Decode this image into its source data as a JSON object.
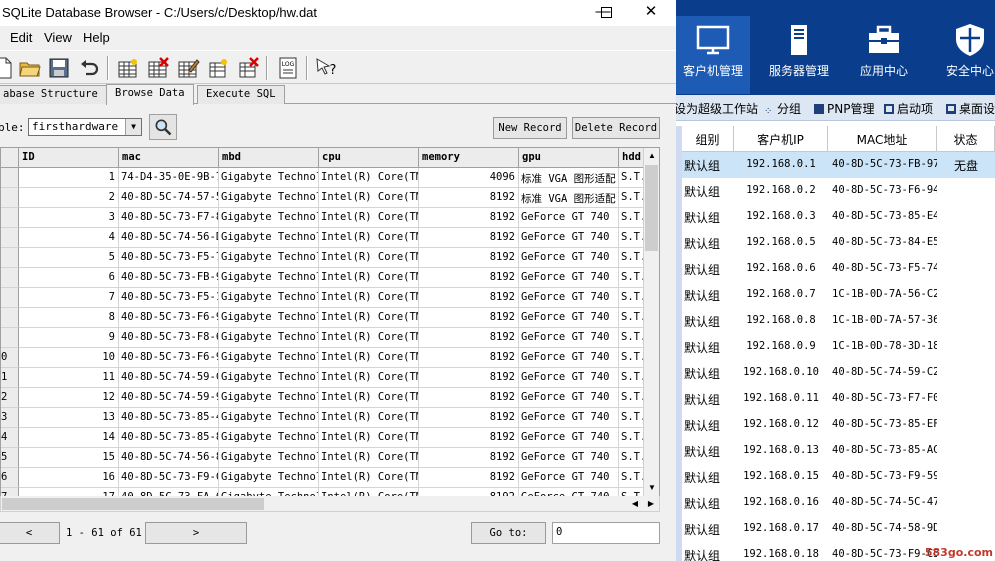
{
  "sqlite": {
    "title": "SQLite Database Browser - C:/Users/c/Desktop/hw.dat",
    "window_controls": {
      "minimize": "—",
      "maximize": "☐",
      "close": "✕"
    },
    "menu": [
      "Edit",
      "View",
      "Help"
    ],
    "toolbar_icons": [
      "new-database-icon",
      "open-database-icon",
      "save-icon",
      "undo-icon",
      "create-table-icon",
      "delete-table-icon",
      "modify-table-icon",
      "create-index-icon",
      "delete-index-icon",
      "log-icon",
      "whats-this-icon"
    ],
    "tabs": [
      "abase Structure",
      "Browse Data",
      "Execute SQL"
    ],
    "active_tab": 1,
    "table_label": "ble:",
    "table_selected": "firsthardware",
    "buttons": {
      "new_record": "New Record",
      "delete_record": "Delete Record"
    },
    "columns": [
      "ID",
      "mac",
      "mbd",
      "cpu",
      "memory",
      "gpu",
      "hdd"
    ],
    "rows": [
      {
        "rownum": "",
        "id": "1",
        "mac": "74-D4-35-0E-9B-7",
        "mbd": "Gigabyte Technol",
        "cpu": "Intel(R) Core(TM",
        "memory": "4096",
        "gpu": "标准 VGA 图形适配",
        "hdd": "S.T."
      },
      {
        "rownum": "",
        "id": "2",
        "mac": "40-8D-5C-74-57-5",
        "mbd": "Gigabyte Technol",
        "cpu": "Intel(R) Core(TM",
        "memory": "8192",
        "gpu": "标准 VGA 图形适配",
        "hdd": "S.T."
      },
      {
        "rownum": "",
        "id": "3",
        "mac": "40-8D-5C-73-F7-8",
        "mbd": "Gigabyte Technol",
        "cpu": "Intel(R) Core(TM",
        "memory": "8192",
        "gpu": "GeForce GT 740",
        "hdd": "S.T."
      },
      {
        "rownum": "",
        "id": "4",
        "mac": "40-8D-5C-74-56-D",
        "mbd": "Gigabyte Technol",
        "cpu": "Intel(R) Core(TM",
        "memory": "8192",
        "gpu": "GeForce GT 740",
        "hdd": "S.T."
      },
      {
        "rownum": "",
        "id": "5",
        "mac": "40-8D-5C-73-F5-7",
        "mbd": "Gigabyte Technol",
        "cpu": "Intel(R) Core(TM",
        "memory": "8192",
        "gpu": "GeForce GT 740",
        "hdd": "S.T."
      },
      {
        "rownum": "",
        "id": "6",
        "mac": "40-8D-5C-73-FB-9",
        "mbd": "Gigabyte Technol",
        "cpu": "Intel(R) Core(TM",
        "memory": "8192",
        "gpu": "GeForce GT 740",
        "hdd": "S.T."
      },
      {
        "rownum": "",
        "id": "7",
        "mac": "40-8D-5C-73-F5-1",
        "mbd": "Gigabyte Technol",
        "cpu": "Intel(R) Core(TM",
        "memory": "8192",
        "gpu": "GeForce GT 740",
        "hdd": "S.T."
      },
      {
        "rownum": "",
        "id": "8",
        "mac": "40-8D-5C-73-F6-9",
        "mbd": "Gigabyte Technol",
        "cpu": "Intel(R) Core(TM",
        "memory": "8192",
        "gpu": "GeForce GT 740",
        "hdd": "S.T."
      },
      {
        "rownum": "",
        "id": "9",
        "mac": "40-8D-5C-73-F8-6",
        "mbd": "Gigabyte Technol",
        "cpu": "Intel(R) Core(TM",
        "memory": "8192",
        "gpu": "GeForce GT 740",
        "hdd": "S.T."
      },
      {
        "rownum": "0",
        "id": "10",
        "mac": "40-8D-5C-73-F6-9",
        "mbd": "Gigabyte Technol",
        "cpu": "Intel(R) Core(TM",
        "memory": "8192",
        "gpu": "GeForce GT 740",
        "hdd": "S.T."
      },
      {
        "rownum": "1",
        "id": "11",
        "mac": "40-8D-5C-74-59-C",
        "mbd": "Gigabyte Technol",
        "cpu": "Intel(R) Core(TM",
        "memory": "8192",
        "gpu": "GeForce GT 740",
        "hdd": "S.T."
      },
      {
        "rownum": "2",
        "id": "12",
        "mac": "40-8D-5C-74-59-9",
        "mbd": "Gigabyte Technol",
        "cpu": "Intel(R) Core(TM",
        "memory": "8192",
        "gpu": "GeForce GT 740",
        "hdd": "S.T."
      },
      {
        "rownum": "3",
        "id": "13",
        "mac": "40-8D-5C-73-85-4",
        "mbd": "Gigabyte Technol",
        "cpu": "Intel(R) Core(TM",
        "memory": "8192",
        "gpu": "GeForce GT 740",
        "hdd": "S.T."
      },
      {
        "rownum": "4",
        "id": "14",
        "mac": "40-8D-5C-73-85-8",
        "mbd": "Gigabyte Technol",
        "cpu": "Intel(R) Core(TM",
        "memory": "8192",
        "gpu": "GeForce GT 740",
        "hdd": "S.T."
      },
      {
        "rownum": "5",
        "id": "15",
        "mac": "40-8D-5C-74-56-8",
        "mbd": "Gigabyte Technol",
        "cpu": "Intel(R) Core(TM",
        "memory": "8192",
        "gpu": "GeForce GT 740",
        "hdd": "S.T."
      },
      {
        "rownum": "6",
        "id": "16",
        "mac": "40-8D-5C-73-F9-C",
        "mbd": "Gigabyte Technol",
        "cpu": "Intel(R) Core(TM",
        "memory": "8192",
        "gpu": "GeForce GT 740",
        "hdd": "S.T."
      },
      {
        "rownum": "7",
        "id": "17",
        "mac": "40-8D-5C-73-FA-6",
        "mbd": "Gigabyte Technol",
        "cpu": "Intel(R) Core(TM",
        "memory": "8192",
        "gpu": "GeForce GT 740",
        "hdd": "S.T."
      }
    ],
    "nav": {
      "prev": "<",
      "page_info": "1 - 61 of 61",
      "next": ">",
      "goto_label": "Go to:",
      "goto_value": "0"
    }
  },
  "client": {
    "nav": [
      {
        "label": "客户机管理",
        "icon": "monitor-icon",
        "active": true
      },
      {
        "label": "服务器管理",
        "icon": "server-icon",
        "active": false
      },
      {
        "label": "应用中心",
        "icon": "toolbox-icon",
        "active": false
      },
      {
        "label": "安全中心",
        "icon": "shield-icon",
        "active": false
      }
    ],
    "toolbar": [
      "设为超级工作站",
      "分组",
      "PNP管理",
      "启动项",
      "桌面设"
    ],
    "columns": [
      "组别",
      "客户机IP",
      "MAC地址",
      "状态"
    ],
    "rows": [
      {
        "group": "默认组",
        "ip": "192.168.0.1",
        "mac": "40-8D-5C-73-FB-97",
        "status": "无盘"
      },
      {
        "group": "默认组",
        "ip": "192.168.0.2",
        "mac": "40-8D-5C-73-F6-94",
        "status": ""
      },
      {
        "group": "默认组",
        "ip": "192.168.0.3",
        "mac": "40-8D-5C-73-85-E4",
        "status": ""
      },
      {
        "group": "默认组",
        "ip": "192.168.0.5",
        "mac": "40-8D-5C-73-84-E5",
        "status": ""
      },
      {
        "group": "默认组",
        "ip": "192.168.0.6",
        "mac": "40-8D-5C-73-F5-74",
        "status": ""
      },
      {
        "group": "默认组",
        "ip": "192.168.0.7",
        "mac": "1C-1B-0D-7A-56-C2",
        "status": ""
      },
      {
        "group": "默认组",
        "ip": "192.168.0.8",
        "mac": "1C-1B-0D-7A-57-36",
        "status": ""
      },
      {
        "group": "默认组",
        "ip": "192.168.0.9",
        "mac": "1C-1B-0D-78-3D-18",
        "status": ""
      },
      {
        "group": "默认组",
        "ip": "192.168.0.10",
        "mac": "40-8D-5C-74-59-C2",
        "status": ""
      },
      {
        "group": "默认组",
        "ip": "192.168.0.11",
        "mac": "40-8D-5C-73-F7-F0",
        "status": ""
      },
      {
        "group": "默认组",
        "ip": "192.168.0.12",
        "mac": "40-8D-5C-73-85-EF",
        "status": ""
      },
      {
        "group": "默认组",
        "ip": "192.168.0.13",
        "mac": "40-8D-5C-73-85-AC",
        "status": ""
      },
      {
        "group": "默认组",
        "ip": "192.168.0.15",
        "mac": "40-8D-5C-73-F9-59",
        "status": ""
      },
      {
        "group": "默认组",
        "ip": "192.168.0.16",
        "mac": "40-8D-5C-74-5C-47",
        "status": ""
      },
      {
        "group": "默认组",
        "ip": "192.168.0.17",
        "mac": "40-8D-5C-74-58-9D",
        "status": ""
      },
      {
        "group": "默认组",
        "ip": "192.168.0.18",
        "mac": "40-8D-5C-73-F9-C5",
        "status": ""
      }
    ],
    "watermark": "583go.com"
  },
  "colors": {
    "nav_bg": "#0a3d8c",
    "nav_active": "#1d5bb5",
    "selected_row": "#cce4f7",
    "watermark": "#c0392b"
  }
}
